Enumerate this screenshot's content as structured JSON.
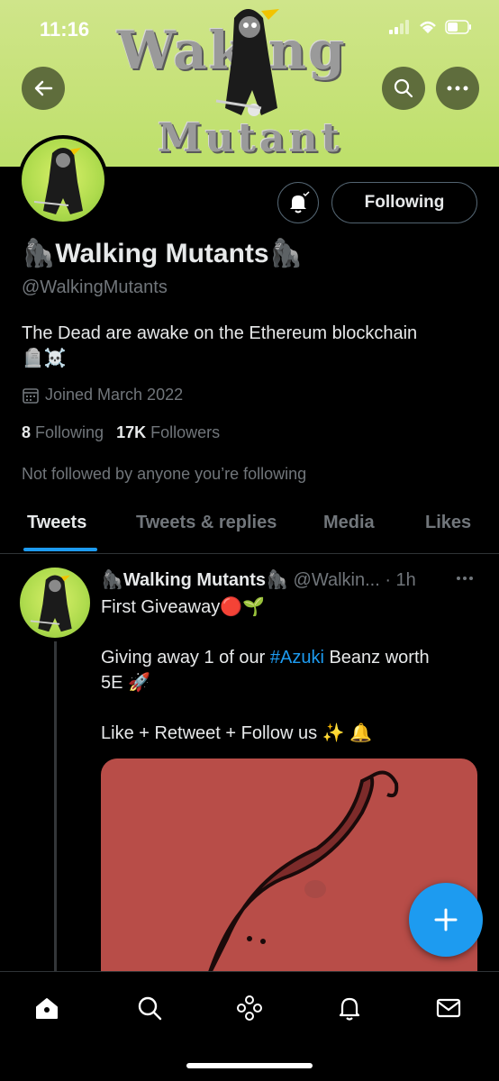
{
  "status_bar": {
    "time": "11:16"
  },
  "banner": {
    "title": "Waking",
    "subtitle": "Mutant"
  },
  "profile": {
    "name": "🦍Walking Mutants🦍",
    "handle": "@WalkingMutants",
    "bio_line1": "The Dead are awake on the Ethereum blockchain",
    "bio_line2": "🪦☠️",
    "joined": "Joined March 2022",
    "following_count": "8",
    "following_label": "Following",
    "followers_count": "17K",
    "followers_label": "Followers",
    "not_followed": "Not followed by anyone you’re following",
    "follow_button_label": "Following"
  },
  "tabs": [
    {
      "label": "Tweets",
      "active": true
    },
    {
      "label": "Tweets & replies",
      "active": false
    },
    {
      "label": "Media",
      "active": false
    },
    {
      "label": "Likes",
      "active": false
    }
  ],
  "tweet": {
    "author_name": "🦍Walking Mutants🦍",
    "author_handle": "@Walkin...",
    "time": "· 1h",
    "line1": "First Giveaway🔴🌱",
    "line2_pre": "Giving away 1 of our ",
    "hashtag": "#Azuki",
    "line2_post": " Beanz worth",
    "line3": "5E 🚀",
    "line4": "Like + Retweet + Follow us ✨ 🔔"
  },
  "icons": {
    "back": "back-arrow-icon",
    "search": "search-icon",
    "more": "more-icon",
    "bell": "bell-icon",
    "compose": "plus-icon",
    "home": "home-icon",
    "explore": "search-icon",
    "spaces": "spaces-icon",
    "notifications": "bell-icon",
    "messages": "mail-icon"
  },
  "colors": {
    "accent": "#1d9bf0",
    "media_bg": "#b84d48",
    "banner": "#c7e27a"
  }
}
